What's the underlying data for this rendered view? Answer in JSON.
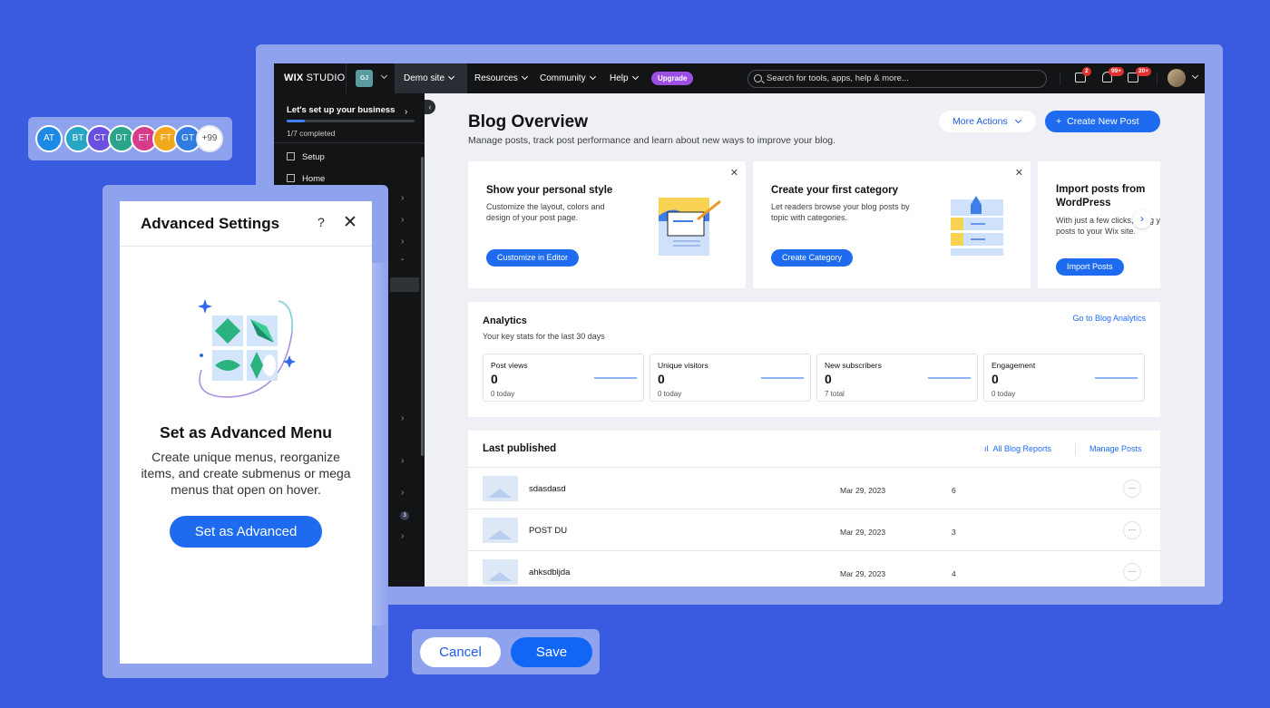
{
  "topbar": {
    "logo_bold": "WIX",
    "logo_rest": " STUDIO",
    "workspace_initials": "GJ",
    "site_name": "Demo site",
    "nav": [
      "Resources",
      "Community",
      "Help"
    ],
    "upgrade": "Upgrade",
    "search_placeholder": "Search for tools, apps, help & more...",
    "badges": {
      "messages": "2",
      "notifications": "99+",
      "inbox": "20+"
    }
  },
  "sidebar": {
    "setup_title": "Let's set up your business",
    "setup_progress": 0.142857,
    "setup_sub": "1/7 completed",
    "items": [
      {
        "label": "Setup",
        "icon": "rocket-icon"
      },
      {
        "label": "Home",
        "icon": "home-icon"
      }
    ],
    "count_badge": "3"
  },
  "main": {
    "title": "Blog Overview",
    "subtitle": "Manage posts, track post performance and learn about new ways to improve your blog.",
    "more_actions": "More Actions",
    "create_new_post": "Create New Post",
    "cards": [
      {
        "title": "Show your personal style",
        "desc": "Customize the layout, colors and design of your post page.",
        "button": "Customize in Editor"
      },
      {
        "title": "Create your first category",
        "desc": "Let readers browse your blog posts by topic with categories.",
        "button": "Create Category"
      },
      {
        "title": "Import posts from WordPress",
        "desc": "With just a few clicks, bring your posts to your Wix site.",
        "button": "Import Posts"
      }
    ],
    "analytics": {
      "title": "Analytics",
      "subtitle": "Your key stats for the last 30 days",
      "link": "Go to Blog Analytics",
      "stats": [
        {
          "label": "Post views",
          "value": "0",
          "foot": "0 today"
        },
        {
          "label": "Unique visitors",
          "value": "0",
          "foot": "0 today"
        },
        {
          "label": "New subscribers",
          "value": "0",
          "foot": "7 total"
        },
        {
          "label": "Engagement",
          "value": "0",
          "foot": "0 today"
        }
      ]
    },
    "published": {
      "title": "Last published",
      "reports": "All Blog Reports",
      "manage": "Manage Posts",
      "rows": [
        {
          "name": "sdasdasd",
          "date": "Mar 29, 2023",
          "views": "6"
        },
        {
          "name": "POST DU",
          "date": "Mar 29, 2023",
          "views": "3"
        },
        {
          "name": "ahksdbljda",
          "date": "Mar 29, 2023",
          "views": "4"
        }
      ]
    }
  },
  "avatars": [
    {
      "initials": "AT",
      "color": "#1e88e5"
    },
    {
      "initials": "BT",
      "color": "#26a6c4"
    },
    {
      "initials": "CT",
      "color": "#6a4fe0"
    },
    {
      "initials": "DT",
      "color": "#2aa58a"
    },
    {
      "initials": "ET",
      "color": "#d63c8a"
    },
    {
      "initials": "FT",
      "color": "#f2a81d"
    },
    {
      "initials": "GT",
      "color": "#2f7be0"
    },
    {
      "initials": "+99",
      "color": "#ffffff"
    }
  ],
  "advanced": {
    "title": "Advanced Settings",
    "help": "?",
    "heading": "Set as Advanced Menu",
    "description": "Create unique menus, reorganize items, and create submenus or mega menus that open on hover.",
    "button": "Set as Advanced"
  },
  "footer_buttons": {
    "cancel": "Cancel",
    "save": "Save"
  },
  "colors": {
    "background": "#3a5be0",
    "accent": "#1f6bf0",
    "upgrade": "#9d4ee3"
  }
}
